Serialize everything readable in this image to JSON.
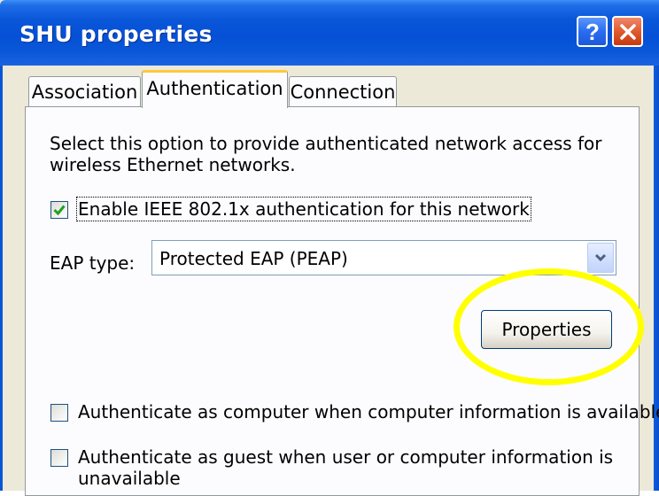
{
  "window": {
    "title": "SHU properties"
  },
  "tabs": [
    {
      "label": "Association"
    },
    {
      "label": "Authentication",
      "selected": true
    },
    {
      "label": "Connection"
    }
  ],
  "authentication": {
    "intro_line1": "Select this option to provide authenticated network access for",
    "intro_line2": "wireless Ethernet networks.",
    "enable_8021x": {
      "label": "Enable IEEE 802.1x authentication for this network",
      "checked": true
    },
    "eap_type_label": "EAP type:",
    "eap_type_value": "Protected EAP (PEAP)",
    "properties_button": "Properties",
    "auth_as_computer": {
      "label": "Authenticate as computer when computer information is available",
      "checked": false
    },
    "auth_as_guest": {
      "label_line1": "Authenticate as guest when user or computer information is",
      "label_line2": "unavailable",
      "checked": false
    }
  },
  "icons": [
    "help-icon",
    "close-icon",
    "checkmark-icon",
    "chevron-down-icon"
  ],
  "colors": {
    "titlebar": "#0550d6",
    "highlight": "#ffff00",
    "checkmark": "#21a121",
    "tab_accent": "#ffc83c"
  }
}
